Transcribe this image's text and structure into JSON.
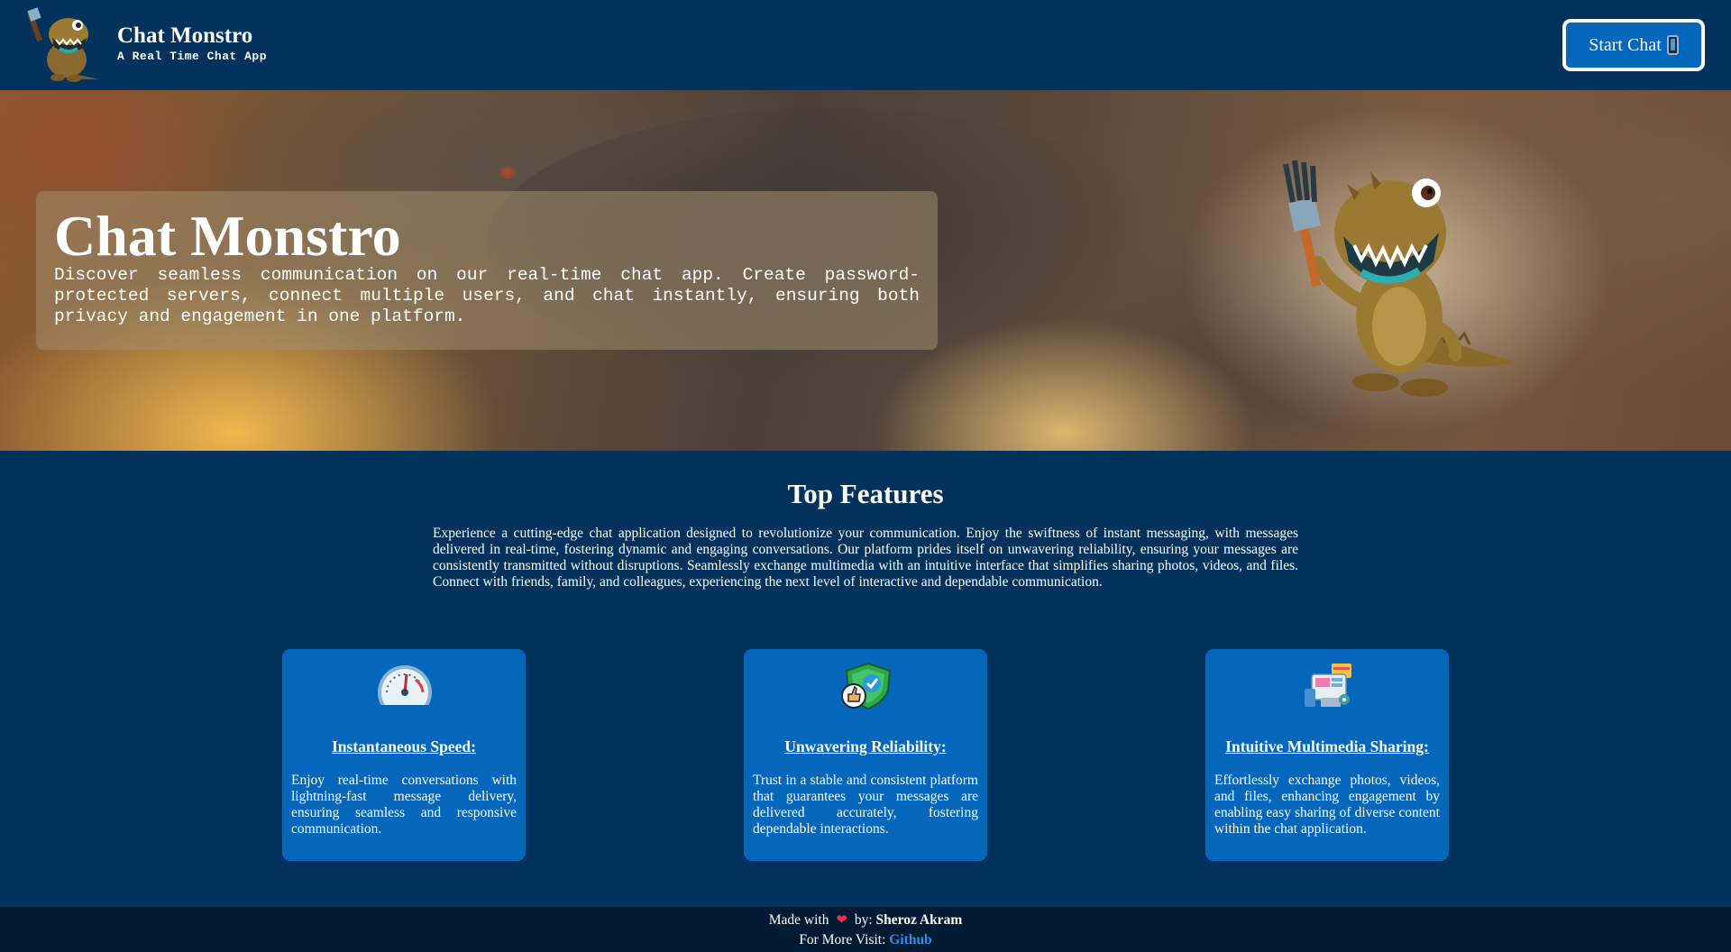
{
  "header": {
    "brand_title": "Chat Monstro",
    "brand_subtitle": "A Real Time Chat App",
    "start_button_label": "Start Chat"
  },
  "hero": {
    "title": "Chat Monstro",
    "description": "Discover seamless communication on our real-time chat app. Create password-protected servers, connect multiple users, and chat instantly, ensuring both privacy and engagement in one platform."
  },
  "features": {
    "title": "Top Features",
    "description": "Experience a cutting-edge chat application designed to revolutionize your communication. Enjoy the swiftness of instant messaging, with messages delivered in real-time, fostering dynamic and engaging conversations. Our platform prides itself on unwavering reliability, ensuring your messages are consistently transmitted without disruptions. Seamlessly exchange multimedia with an intuitive interface that simplifies sharing photos, videos, and files. Connect with friends, family, and colleagues, experiencing the next level of interactive and dependable communication.",
    "cards": [
      {
        "icon": "speedometer-icon",
        "title": "Instantaneous Speed:",
        "text": "Enjoy real-time conversations with lightning-fast message delivery, ensuring seamless and responsive communication."
      },
      {
        "icon": "shield-check-icon",
        "title": "Unwavering Reliability:",
        "text": "Trust in a stable and consistent platform that guarantees your messages are delivered accurately, fostering dependable interactions."
      },
      {
        "icon": "multimedia-icon",
        "title": "Intuitive Multimedia Sharing:",
        "text": "Effortlessly exchange photos, videos, and files, enhancing engagement by enabling easy sharing of diverse content within the chat application."
      }
    ]
  },
  "footer": {
    "made_with": "Made with",
    "by": "by:",
    "author": "Sheroz Akram",
    "more_visit": "For More Visit:",
    "link_label": "Github"
  },
  "colors": {
    "background": "#03335c",
    "card": "#0467bb",
    "footer": "#021a33",
    "link": "#2f8fe6"
  }
}
